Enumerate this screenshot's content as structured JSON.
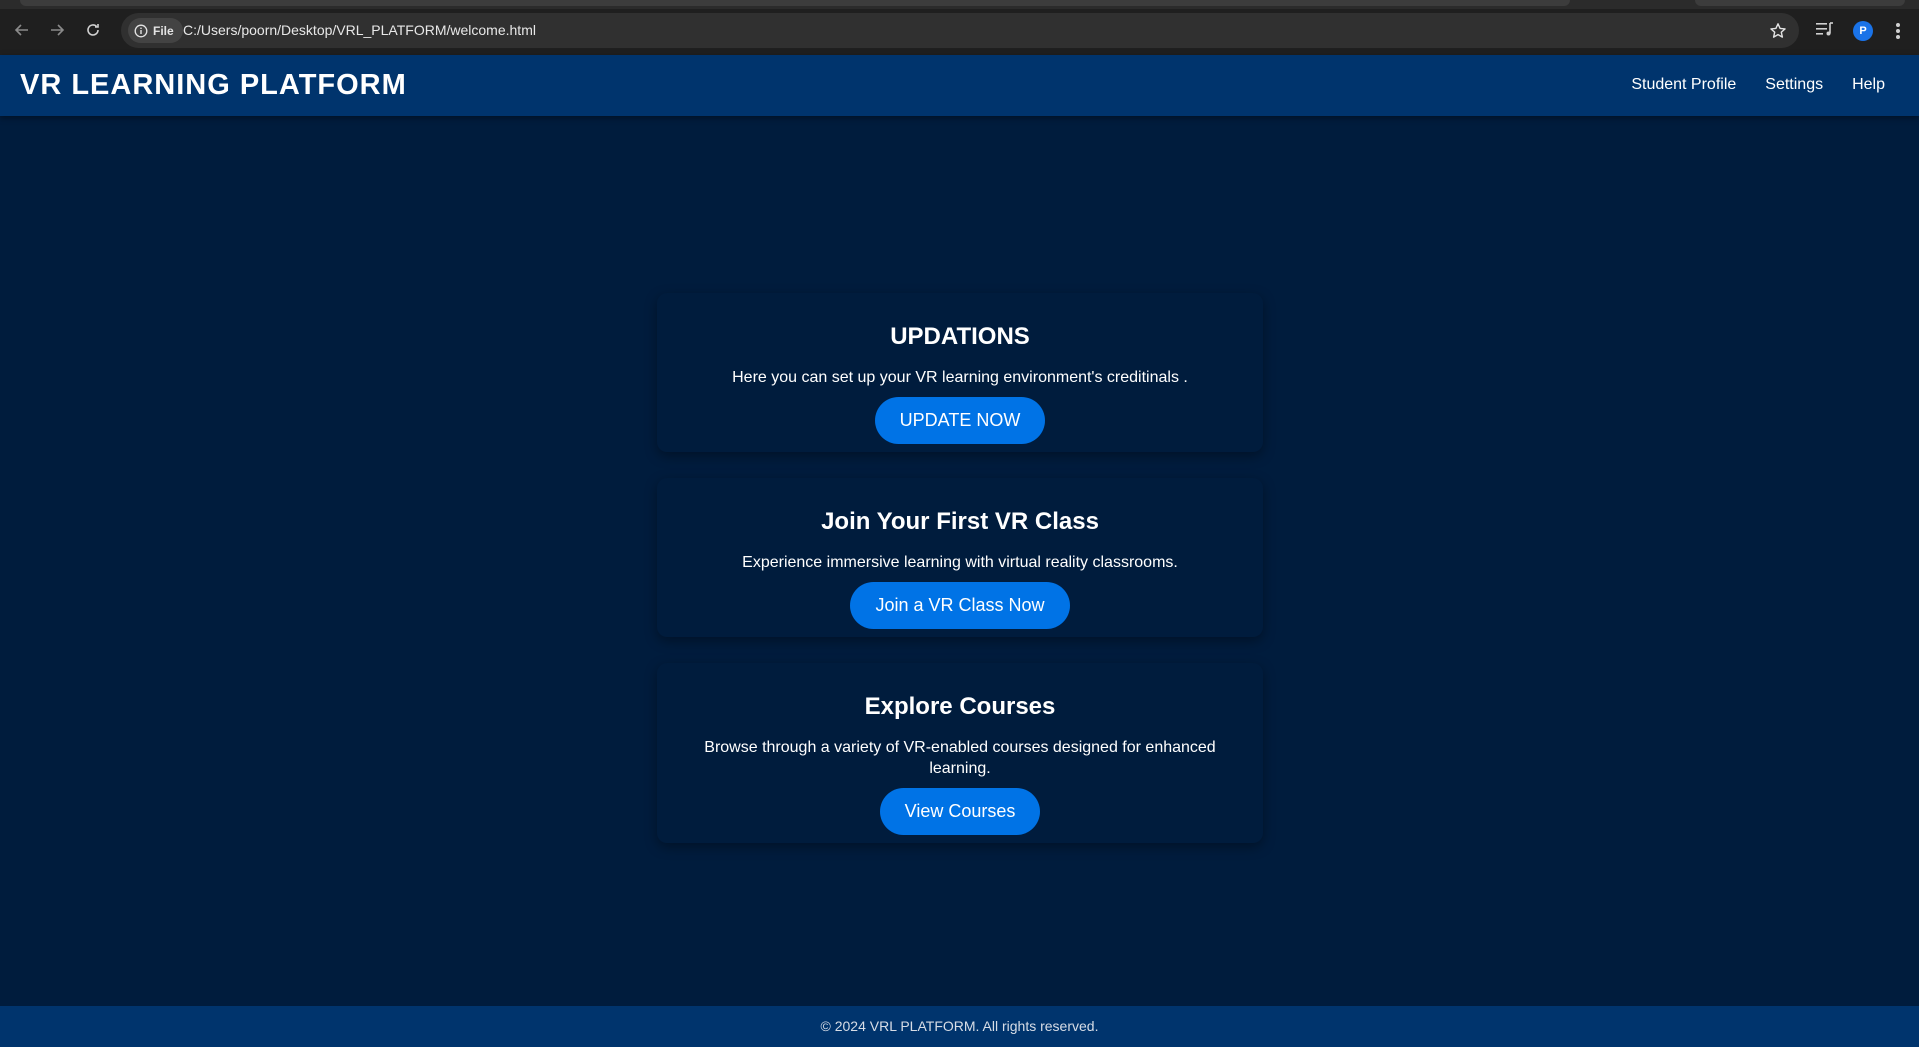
{
  "browser": {
    "scheme_chip": "File",
    "url": "C:/Users/poorn/Desktop/VRL_PLATFORM/welcome.html",
    "profile_initial": "P",
    "icons": [
      "back-arrow-icon",
      "forward-arrow-icon",
      "reload-icon",
      "info-icon",
      "star-icon",
      "media-control-icon",
      "kebab-menu-icon"
    ]
  },
  "header": {
    "brand": "VR LEARNING PLATFORM",
    "nav": [
      "Student Profile",
      "Settings",
      "Help"
    ]
  },
  "cards": [
    {
      "title": "UPDATIONS",
      "text": "Here you can set up your VR learning environment's creditinals .",
      "button": "UPDATE NOW"
    },
    {
      "title": "Join Your First VR Class",
      "text": "Experience immersive learning with virtual reality classrooms.",
      "button": "Join a VR Class Now"
    },
    {
      "title": "Explore Courses",
      "text": "Browse through a variety of VR-enabled courses designed for enhanced learning.",
      "button": "View Courses"
    }
  ],
  "footer": {
    "text": "© 2024 VRL PLATFORM. All rights reserved."
  },
  "colors": {
    "page_bg": "#001c3d",
    "header_bg": "#00346d",
    "button_bg": "#0073e6",
    "text": "#ffffff"
  }
}
